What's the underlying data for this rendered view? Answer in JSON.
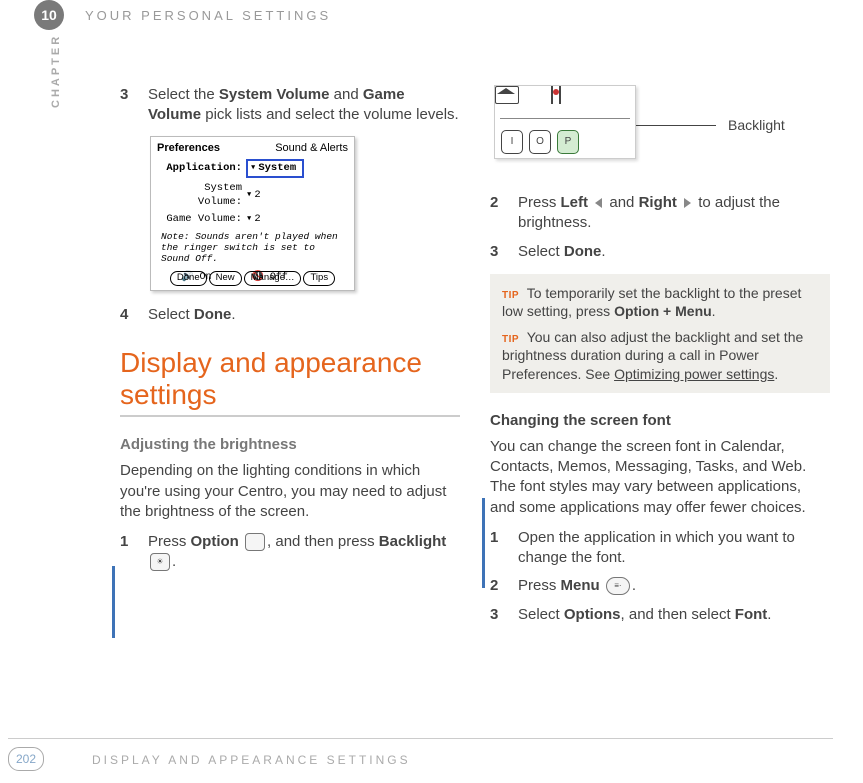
{
  "header": {
    "chapter_num": "10",
    "chapter_title": "YOUR PERSONAL SETTINGS",
    "chapter_label": "CHAPTER"
  },
  "footer": {
    "page_num": "202",
    "footer_title": "DISPLAY AND APPEARANCE SETTINGS"
  },
  "left": {
    "step3": {
      "num": "3",
      "t1": "Select the ",
      "b1": "System Volume",
      "t2": " and ",
      "b2": "Game Volume",
      "t3": " pick lists and select the volume levels."
    },
    "prefs": {
      "titlebar_left": "Preferences",
      "titlebar_right": "Sound & Alerts",
      "app_label": "Application:",
      "app_value": "System",
      "sysvol_label": "System Volume:",
      "sysvol_value": "2",
      "gamevol_label": "Game Volume:",
      "gamevol_value": "2",
      "note": "Note: Sounds aren't played when the ringer switch is set to Sound Off.",
      "on": "On",
      "off": "Off",
      "btn_done": "Done",
      "btn_new": "New",
      "btn_manage": "Manage…",
      "btn_tips": "Tips"
    },
    "step4": {
      "num": "4",
      "t1": "Select ",
      "b1": "Done",
      "t2": "."
    },
    "section_heading": "Display and appearance settings",
    "sub_heading": "Adjusting the brightness",
    "intro": "Depending on the lighting conditions in which you're using your Centro, you may need to adjust the brightness of the screen.",
    "bright_step1": {
      "num": "1",
      "t1": "Press ",
      "b1": "Option",
      "t2": ", and then press ",
      "b2": "Backlight",
      "t3": "."
    }
  },
  "right": {
    "callout_label": "Backlight",
    "keys": {
      "i": "I",
      "o": "O",
      "p": "P"
    },
    "step2": {
      "num": "2",
      "t1": "Press ",
      "b1": "Left",
      "t2": " and ",
      "b2": "Right",
      "t3": " to adjust the brightness."
    },
    "step3": {
      "num": "3",
      "t1": "Select ",
      "b1": "Done",
      "t2": "."
    },
    "tip_label": "TIP",
    "tip1": {
      "t1": "To temporarily set the backlight to the preset low setting, press ",
      "b1": "Option + Menu",
      "t2": "."
    },
    "tip2": {
      "t1": "You can also adjust the backlight and set the brightness duration during a call in Power Preferences. See ",
      "link": "Optimizing power settings",
      "t2": "."
    },
    "font_heading": "Changing the screen font",
    "font_intro": "You can change the screen font in Calendar, Contacts, Memos, Messaging, Tasks, and Web. The font styles may vary between applications, and some applications may offer fewer choices.",
    "fstep1": {
      "num": "1",
      "text": "Open the application in which you want to change the font."
    },
    "fstep2": {
      "num": "2",
      "t1": "Press ",
      "b1": "Menu",
      "t2": "."
    },
    "fstep3": {
      "num": "3",
      "t1": "Select ",
      "b1": "Options",
      "t2": ", and then select ",
      "b2": "Font",
      "t3": "."
    }
  }
}
